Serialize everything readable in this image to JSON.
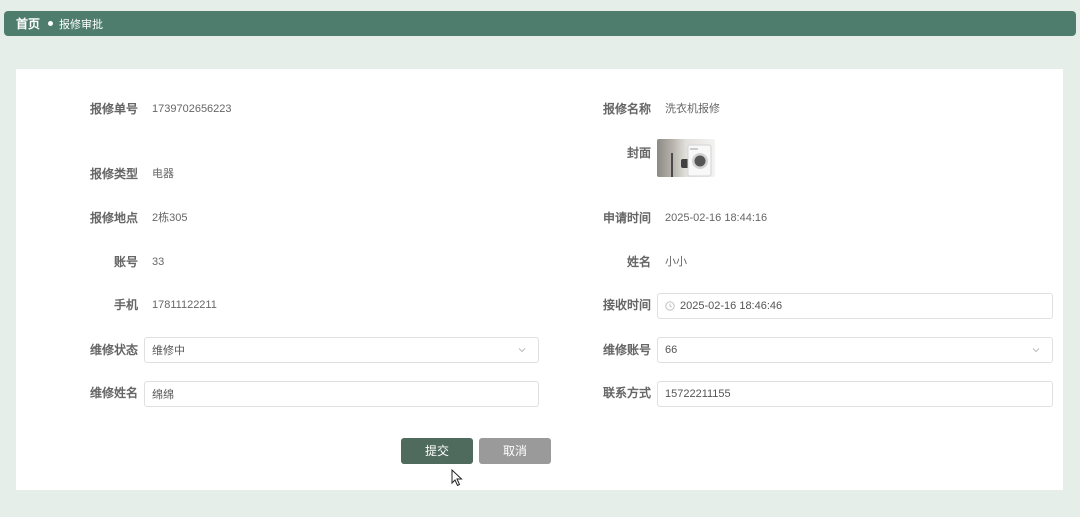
{
  "breadcrumb": {
    "home": "首页",
    "current": "报修审批"
  },
  "form": {
    "order_no": {
      "label": "报修单号",
      "value": "1739702656223"
    },
    "repair_name": {
      "label": "报修名称",
      "value": "洗衣机报修"
    },
    "cover": {
      "label": "封面",
      "icon": "washing-machine-photo"
    },
    "repair_type": {
      "label": "报修类型",
      "value": "电器"
    },
    "location": {
      "label": "报修地点",
      "value": "2栋305"
    },
    "apply_time": {
      "label": "申请时间",
      "value": "2025-02-16 18:44:16"
    },
    "account": {
      "label": "账号",
      "value": "33"
    },
    "name": {
      "label": "姓名",
      "value": "小小"
    },
    "phone": {
      "label": "手机",
      "value": "17811122211"
    },
    "receive_time": {
      "label": "接收时间",
      "value": "2025-02-16 18:46:46"
    },
    "repair_status": {
      "label": "维修状态",
      "value": "维修中"
    },
    "repair_account": {
      "label": "维修账号",
      "value": "66"
    },
    "repair_person": {
      "label": "维修姓名",
      "value": "绵绵"
    },
    "contact": {
      "label": "联系方式",
      "value": "15722211155"
    }
  },
  "buttons": {
    "submit": "提交",
    "cancel": "取消"
  },
  "colors": {
    "accent": "#4f7d6d",
    "submit": "#4f6b5d",
    "cancel": "#9a9a9a",
    "background": "#e6eeea"
  }
}
